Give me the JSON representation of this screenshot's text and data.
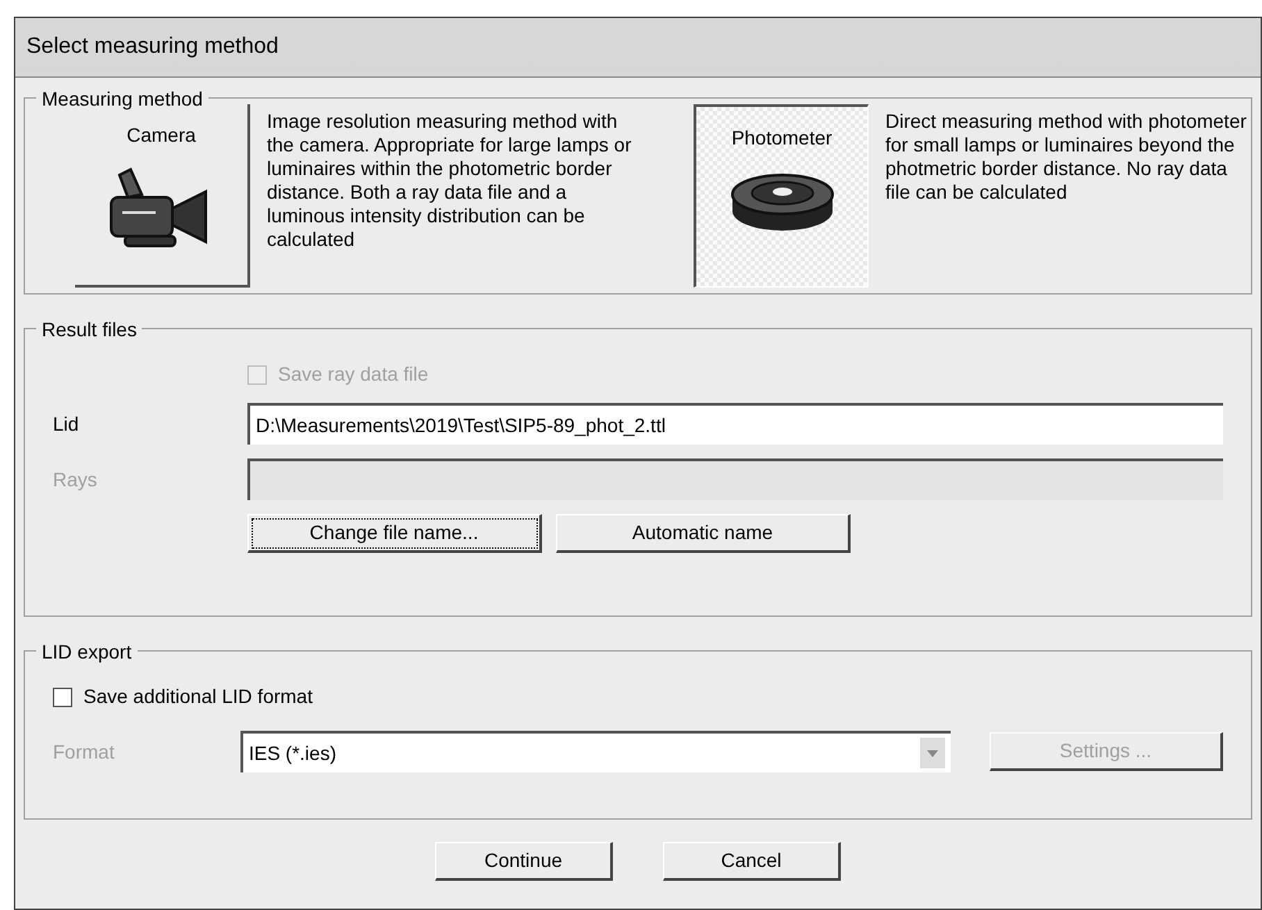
{
  "window": {
    "title": "Select measuring method"
  },
  "measuring_method": {
    "label": "Measuring method",
    "options": [
      {
        "kind": "camera",
        "label": "Camera",
        "selected": false,
        "description": "Image resolution measuring method with the camera. Appropriate for large lamps or luminaires within the photometric border distance. Both a ray data file and a luminous intensity distribution can be calculated"
      },
      {
        "kind": "photometer",
        "label": "Photometer",
        "selected": true,
        "description": "Direct measuring method with photometer for small lamps or luminaires beyond the photmetric border distance. No ray data file can be calculated"
      }
    ]
  },
  "result_files": {
    "label": "Result files",
    "save_ray": {
      "label": "Save ray data file",
      "checked": false,
      "disabled": true
    },
    "fields": [
      {
        "label": "Lid",
        "value": "D:\\Measurements\\2019\\Test\\SIP5-89_phot_2.ttl",
        "disabled": false
      },
      {
        "label": "Rays",
        "disabled": true
      }
    ],
    "buttons": [
      {
        "label": "Change file name...",
        "focused": true
      },
      {
        "label": "Automatic name",
        "focused": false
      }
    ]
  },
  "lid_export": {
    "label": "LID export",
    "save_additional": {
      "label": "Save additional LID format",
      "checked": false,
      "disabled": false
    },
    "format": {
      "label": "Format",
      "value": "IES (*.ies)",
      "disabled": true
    },
    "settings": {
      "label": "Settings ...",
      "disabled": true
    }
  },
  "buttons": [
    "Continue",
    "Cancel"
  ]
}
